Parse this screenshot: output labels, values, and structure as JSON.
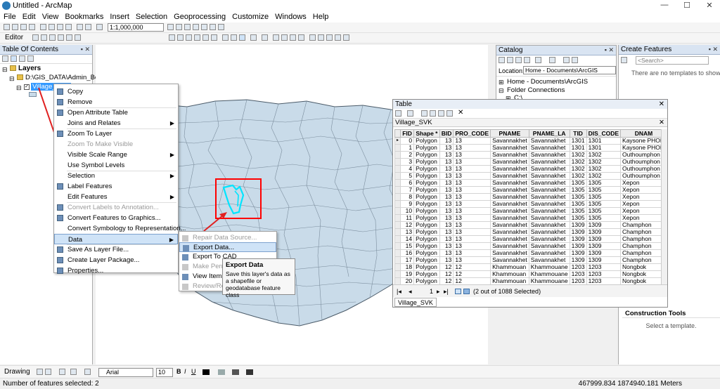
{
  "window": {
    "title": "Untitled - ArcMap",
    "min": "—",
    "max": "☐",
    "close": "✕"
  },
  "menubar": [
    "File",
    "Edit",
    "View",
    "Bookmarks",
    "Insert",
    "Selection",
    "Geoprocessing",
    "Customize",
    "Windows",
    "Help"
  ],
  "toolbar": {
    "scale": "1:1,000,000",
    "editor_label": "Editor"
  },
  "toc": {
    "title": "Table Of Contents",
    "layers_label": "Layers",
    "group_path": "D:\\GIS_DATA\\Admin_Bound",
    "layer_name": "Village_SVK"
  },
  "context_menu": {
    "items": [
      {
        "label": "Copy",
        "disabled": false,
        "submenu": false
      },
      {
        "label": "Remove",
        "disabled": false,
        "submenu": false
      },
      {
        "label": "Open Attribute Table",
        "disabled": false,
        "submenu": false
      },
      {
        "label": "Joins and Relates",
        "disabled": false,
        "submenu": true
      },
      {
        "label": "Zoom To Layer",
        "disabled": false,
        "submenu": false
      },
      {
        "label": "Zoom To Make Visible",
        "disabled": true,
        "submenu": false
      },
      {
        "label": "Visible Scale Range",
        "disabled": false,
        "submenu": true
      },
      {
        "label": "Use Symbol Levels",
        "disabled": false,
        "submenu": false
      },
      {
        "label": "Selection",
        "disabled": false,
        "submenu": true
      },
      {
        "label": "Label Features",
        "disabled": false,
        "submenu": false
      },
      {
        "label": "Edit Features",
        "disabled": false,
        "submenu": true
      },
      {
        "label": "Convert Labels to Annotation...",
        "disabled": true,
        "submenu": false
      },
      {
        "label": "Convert Features to Graphics...",
        "disabled": false,
        "submenu": false
      },
      {
        "label": "Convert Symbology to Representation...",
        "disabled": false,
        "submenu": false
      },
      {
        "label": "Data",
        "disabled": false,
        "submenu": true
      },
      {
        "label": "Save As Layer File...",
        "disabled": false,
        "submenu": false
      },
      {
        "label": "Create Layer Package...",
        "disabled": false,
        "submenu": false
      },
      {
        "label": "Properties...",
        "disabled": false,
        "submenu": false
      }
    ]
  },
  "submenu": {
    "items": [
      {
        "label": "Repair Data Source...",
        "disabled": true
      },
      {
        "label": "Export Data...",
        "disabled": false
      },
      {
        "label": "Export To CAD",
        "disabled": false
      },
      {
        "label": "Make Perma",
        "disabled": true
      },
      {
        "label": "View Item D",
        "disabled": false
      },
      {
        "label": "Review/Rem",
        "disabled": true
      }
    ]
  },
  "tooltip": {
    "title": "Export Data",
    "body": "Save this layer's data as a shapefile or geodatabase feature class"
  },
  "catalog": {
    "title": "Catalog",
    "location_label": "Location:",
    "location_value": "Home - Documents\\ArcGIS",
    "items": [
      "Home - Documents\\ArcGIS",
      "Folder Connections",
      "C:\\"
    ]
  },
  "create_features": {
    "title": "Create Features",
    "search_placeholder": "<Search>",
    "empty_msg": "There are no templates to show."
  },
  "construction": {
    "title": "Construction Tools",
    "msg": "Select a template."
  },
  "table": {
    "title": "Table",
    "layer_tab": "Village_SVK",
    "columns": [
      "FID",
      "Shape *",
      "BID",
      "PRO_CODE",
      "PNAME",
      "PNAME_LA",
      "TID",
      "DIS_CODE",
      "DNAM"
    ],
    "rows": [
      [
        "0",
        "Polygon",
        "13",
        "13",
        "Savannakhet",
        "Savannakhet",
        "1301",
        "1301",
        "Kaysone PHOM"
      ],
      [
        "1",
        "Polygon",
        "13",
        "13",
        "Savannakhet",
        "Savannakhet",
        "1301",
        "1301",
        "Kaysone PHOM"
      ],
      [
        "2",
        "Polygon",
        "13",
        "13",
        "Savannakhet",
        "Savannakhet",
        "1302",
        "1302",
        "Outhoumphon"
      ],
      [
        "3",
        "Polygon",
        "13",
        "13",
        "Savannakhet",
        "Savannakhet",
        "1302",
        "1302",
        "Outhoumphon"
      ],
      [
        "4",
        "Polygon",
        "13",
        "13",
        "Savannakhet",
        "Savannakhet",
        "1302",
        "1302",
        "Outhoumphon"
      ],
      [
        "5",
        "Polygon",
        "13",
        "13",
        "Savannakhet",
        "Savannakhet",
        "1302",
        "1302",
        "Outhoumphon"
      ],
      [
        "6",
        "Polygon",
        "13",
        "13",
        "Savannakhet",
        "Savannakhet",
        "1305",
        "1305",
        "Xepon"
      ],
      [
        "7",
        "Polygon",
        "13",
        "13",
        "Savannakhet",
        "Savannakhet",
        "1305",
        "1305",
        "Xepon"
      ],
      [
        "8",
        "Polygon",
        "13",
        "13",
        "Savannakhet",
        "Savannakhet",
        "1305",
        "1305",
        "Xepon"
      ],
      [
        "9",
        "Polygon",
        "13",
        "13",
        "Savannakhet",
        "Savannakhet",
        "1305",
        "1305",
        "Xepon"
      ],
      [
        "10",
        "Polygon",
        "13",
        "13",
        "Savannakhet",
        "Savannakhet",
        "1305",
        "1305",
        "Xepon"
      ],
      [
        "11",
        "Polygon",
        "13",
        "13",
        "Savannakhet",
        "Savannakhet",
        "1305",
        "1305",
        "Xepon"
      ],
      [
        "12",
        "Polygon",
        "13",
        "13",
        "Savannakhet",
        "Savannakhet",
        "1309",
        "1309",
        "Champhon"
      ],
      [
        "13",
        "Polygon",
        "13",
        "13",
        "Savannakhet",
        "Savannakhet",
        "1309",
        "1309",
        "Champhon"
      ],
      [
        "14",
        "Polygon",
        "13",
        "13",
        "Savannakhet",
        "Savannakhet",
        "1309",
        "1309",
        "Champhon"
      ],
      [
        "15",
        "Polygon",
        "13",
        "13",
        "Savannakhet",
        "Savannakhet",
        "1309",
        "1309",
        "Champhon"
      ],
      [
        "16",
        "Polygon",
        "13",
        "13",
        "Savannakhet",
        "Savannakhet",
        "1309",
        "1309",
        "Champhon"
      ],
      [
        "17",
        "Polygon",
        "13",
        "13",
        "Savannakhet",
        "Savannakhet",
        "1309",
        "1309",
        "Champhon"
      ],
      [
        "18",
        "Polygon",
        "12",
        "12",
        "Khammouan",
        "Khammouane",
        "1203",
        "1203",
        "Nongbok"
      ],
      [
        "19",
        "Polygon",
        "12",
        "12",
        "Khammouan",
        "Khammouane",
        "1203",
        "1203",
        "Nongbok"
      ],
      [
        "20",
        "Polygon",
        "12",
        "12",
        "Khammouan",
        "Khammouane",
        "1203",
        "1203",
        "Nongbok"
      ]
    ],
    "nav_page": "1",
    "selected_text": "(2 out of 1088 Selected)"
  },
  "drawing": {
    "label": "Drawing",
    "font": "Arial",
    "size": "10"
  },
  "status": {
    "left": "Number of features selected: 2",
    "coords": "467999.834  1874940.181 Meters"
  },
  "colors": {
    "map_fill": "#c9dbe9",
    "selected": "#00e5ff",
    "highlight": "#ff0000",
    "accent": "#3399ff"
  }
}
